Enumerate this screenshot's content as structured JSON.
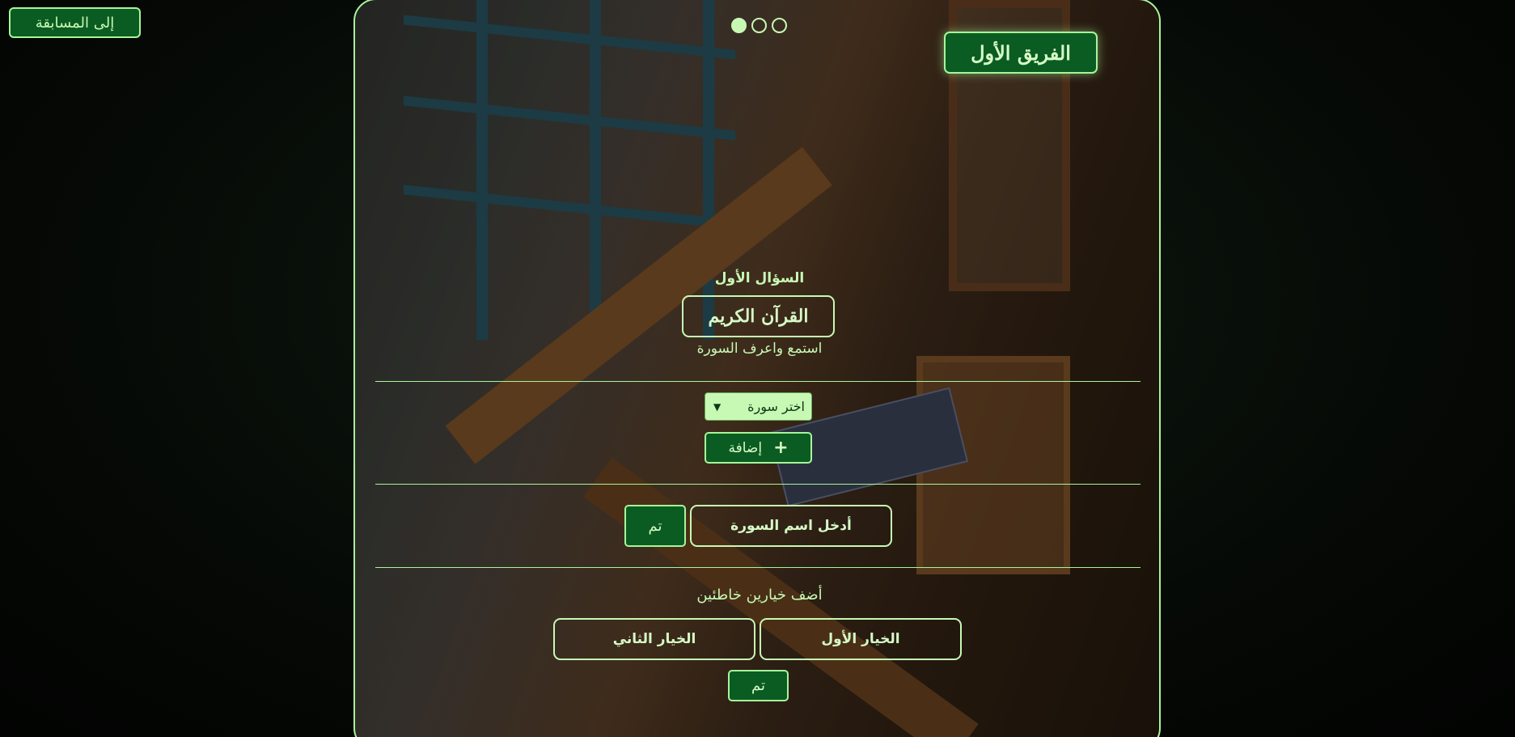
{
  "top_nav": {
    "back_label": "إلى المسابقة"
  },
  "panel": {
    "pagination": {
      "count": 3,
      "active_index": 0
    },
    "team_name": "الفريق الأول",
    "question": {
      "label": "السؤال الأول",
      "category": "القرآن الكريم",
      "hint": "استمع واعرف السورة"
    },
    "surah_select": {
      "selected": "اختر سورة"
    },
    "add_button": {
      "label": "إضافة",
      "icon": "plus-icon"
    },
    "answer_section": {
      "input_placeholder": "أدخل اسم السورة",
      "done_label": "تم"
    },
    "wrong_options": {
      "title": "أضف خيارين خاطئين",
      "first_label": "الخيار الأول",
      "second_label": "الخيار الثاني",
      "done_label": "تم"
    }
  },
  "colors": {
    "accent": "#a8f59a",
    "button_bg": "#0b5c22",
    "text": "#c8f9b4"
  }
}
